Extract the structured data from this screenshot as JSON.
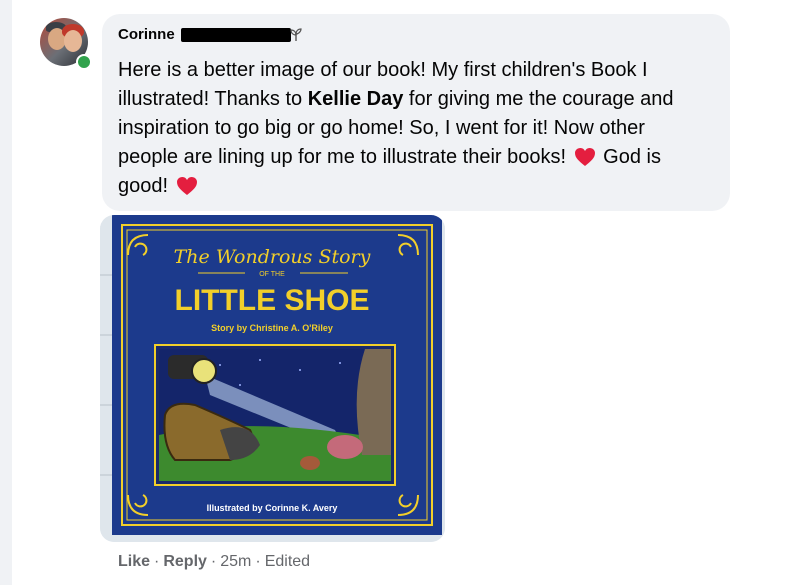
{
  "top_fragment": "· · · ·",
  "comment": {
    "author": "Corinne",
    "text_part1": "Here is a better image of our book! My first children's Book I illustrated! Thanks to ",
    "mention": "Kellie Day",
    "text_part2": " for giving me the courage and inspiration to go big or go home! So, I went for it! Now other people are lining up for me to illustrate their books! ",
    "text_part3": " God is good! ",
    "icons": [
      "heart-icon",
      "plant-icon"
    ]
  },
  "book_cover": {
    "title_top": "The Wondrous Story",
    "of_the": "OF THE",
    "title_main": "LITTLE SHOE",
    "byline": "Story by Christine A. O'Riley",
    "illustrator": "Illustrated by Corinne K. Avery"
  },
  "footer": {
    "like": "Like",
    "reply": "Reply",
    "time": "25m",
    "edited": "Edited"
  },
  "colors": {
    "bubble": "#f0f2f5",
    "text": "#050505",
    "meta": "#65676b",
    "online": "#31a24c",
    "cover_blue": "#1c3a8c",
    "cover_yellow": "#f2cf2a",
    "heart": "#e41e3f"
  }
}
